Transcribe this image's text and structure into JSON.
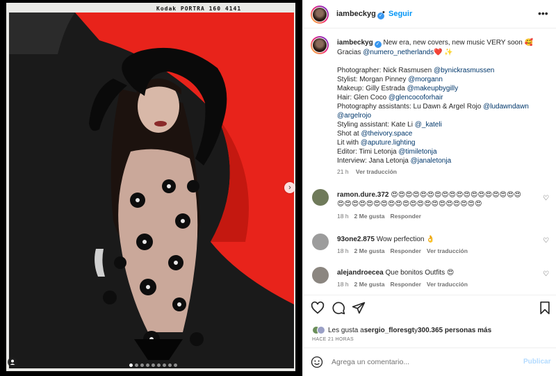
{
  "post": {
    "film_edge_text": "Kodak PORTRA 160 4141",
    "carousel": {
      "dot_count": 9,
      "active_index": 0
    }
  },
  "header": {
    "username": "iambeckyg",
    "separator": "•",
    "follow_label": "Seguir",
    "more_icon": "more-options-icon"
  },
  "caption": {
    "username": "iambeckyg",
    "lines": [
      [
        {
          "t": "New era, new covers, new music VERY soon 🥰",
          "k": "text"
        }
      ],
      [
        {
          "t": "Gracias ",
          "k": "text"
        },
        {
          "t": "@numero_netherlands",
          "k": "tag"
        },
        {
          "t": "❤️ ✨",
          "k": "text"
        }
      ],
      [],
      [
        {
          "t": "Photographer: Nick Rasmusen ",
          "k": "text"
        },
        {
          "t": "@bynickrasmussen",
          "k": "tag"
        }
      ],
      [
        {
          "t": "Stylist: Morgan Pinney ",
          "k": "text"
        },
        {
          "t": "@morgann",
          "k": "tag"
        }
      ],
      [
        {
          "t": "Makeup: Gilly Estrada ",
          "k": "text"
        },
        {
          "t": "@makeupbygilly",
          "k": "tag"
        }
      ],
      [
        {
          "t": "Hair: Glen Coco ",
          "k": "text"
        },
        {
          "t": "@glencocoforhair",
          "k": "tag"
        }
      ],
      [
        {
          "t": "Photography assistants: Lu Dawn & Argel Rojo ",
          "k": "text"
        },
        {
          "t": "@ludawndawn",
          "k": "tag"
        }
      ],
      [
        {
          "t": "@argelrojo",
          "k": "tag"
        }
      ],
      [
        {
          "t": "Styling assistant: Kate Li ",
          "k": "text"
        },
        {
          "t": "@_kateli",
          "k": "tag"
        }
      ],
      [
        {
          "t": "Shot at ",
          "k": "text"
        },
        {
          "t": "@theivory.space",
          "k": "tag"
        }
      ],
      [
        {
          "t": "Lit with ",
          "k": "text"
        },
        {
          "t": "@aputure.lighting",
          "k": "tag"
        }
      ],
      [
        {
          "t": "Editor: Timi Letonja ",
          "k": "text"
        },
        {
          "t": "@timiletonja",
          "k": "tag"
        }
      ],
      [
        {
          "t": "Interview: Jana Letonja ",
          "k": "text"
        },
        {
          "t": "@janaletonja",
          "k": "tag"
        }
      ]
    ],
    "time": "21 h",
    "translate": "Ver traducción"
  },
  "comments": [
    {
      "username": "ramon.dure.372",
      "text_line1": "😍😍😍😍😍😍😍😍😍😍😍😍😍😍😍😍😍😍",
      "text_line2": "😍😍😍😍😍😍😍😍😍😍😍😍😍😍😍😍😍😍😍😍",
      "time": "18 h",
      "likes": "2 Me gusta",
      "reply": "Responder",
      "translate": ""
    },
    {
      "username": "93one2.875",
      "text_line1": "Wow perfection 👌",
      "text_line2": "",
      "time": "18 h",
      "likes": "2 Me gusta",
      "reply": "Responder",
      "translate": "Ver traducción"
    },
    {
      "username": "alejandroecea",
      "text_line1": "Que bonitos Outfits 😍",
      "text_line2": "",
      "time": "18 h",
      "likes": "2 Me gusta",
      "reply": "Responder",
      "translate": "Ver traducción"
    }
  ],
  "likes": {
    "prefix": "Les gusta a ",
    "user": "sergio_floresgt",
    "mid": " y ",
    "count": "300.365 personas más"
  },
  "timestamp": "HACE 21 HORAS",
  "add_comment": {
    "placeholder": "Agrega un comentario...",
    "post_label": "Publicar"
  },
  "colors": {
    "link": "#00376b",
    "follow": "#0095f6",
    "muted": "#737373",
    "post_disabled": "#b3dbff",
    "photo_red": "#e8231b"
  }
}
